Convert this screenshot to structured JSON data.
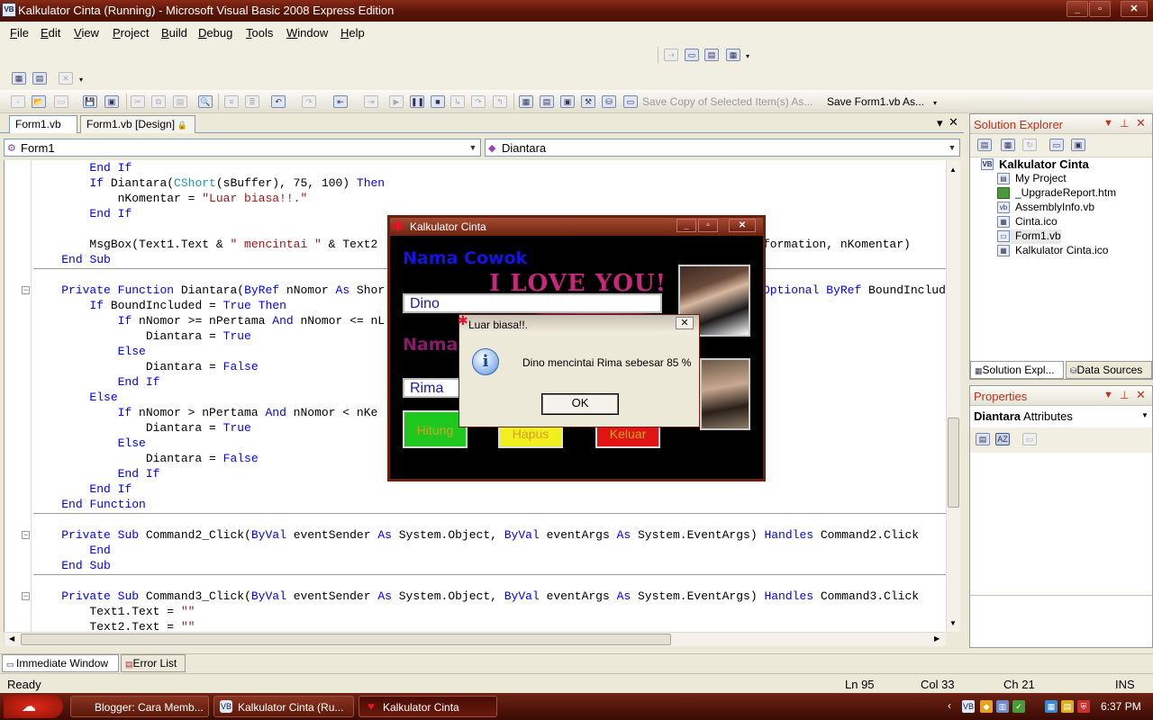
{
  "window": {
    "title": "Kalkulator Cinta (Running) - Microsoft Visual Basic 2008 Express Edition",
    "app_icon": "VB",
    "controls": {
      "minimize": "_",
      "maximize": "▫",
      "close": "✕"
    }
  },
  "menu": [
    {
      "label": "File",
      "u": "F",
      "rest": "ile"
    },
    {
      "label": "Edit",
      "u": "E",
      "rest": "dit"
    },
    {
      "label": "View",
      "u": "V",
      "rest": "iew"
    },
    {
      "label": "Project",
      "u": "P",
      "rest": "roject"
    },
    {
      "label": "Build",
      "u": "B",
      "rest": "uild"
    },
    {
      "label": "Debug",
      "u": "D",
      "rest": "ebug"
    },
    {
      "label": "Tools",
      "u": "T",
      "rest": "ools"
    },
    {
      "label": "Window",
      "u": "W",
      "rest": "indow"
    },
    {
      "label": "Help",
      "u": "H",
      "rest": "elp"
    }
  ],
  "toolbar": {
    "save_copy_label": "Save Copy of Selected Item(s) As...",
    "save_form_label": "Save Form1.vb As..."
  },
  "tabs": [
    {
      "label": "Form1.vb",
      "active": true
    },
    {
      "label": "Form1.vb [Design]",
      "active": false
    }
  ],
  "editor": {
    "class_combo": "Form1",
    "member_combo": "Diantara",
    "close_glyph": "✕"
  },
  "code_lines": [
    "        End If",
    "        If Diantara(CShort(sBuffer), 75, 100) Then",
    "            nKomentar = \"Luar biasa!!.\"",
    "        End If",
    "",
    "        MsgBox(Text1.Text & \" mencintai \" & Text2",
    "    End Sub",
    "",
    "    Private Function Diantara(ByRef nNomor As Shor",
    "        If BoundIncluded = True Then",
    "            If nNomor >= nPertama And nNomor <= nL",
    "                Diantara = True",
    "            Else",
    "                Diantara = False",
    "            End If",
    "        Else",
    "            If nNomor > nPertama And nNomor < nKe",
    "                Diantara = True",
    "            Else",
    "                Diantara = False",
    "            End If",
    "        End If",
    "    End Function",
    "",
    "    Private Sub Command2_Click(ByVal eventSender As System.Object, ByVal eventArgs As System.EventArgs) Handles Command2.Click",
    "        End",
    "    End Sub",
    "",
    "    Private Sub Command3_Click(ByVal eventSender As System.Object, ByVal eventArgs As System.EventArgs) Handles Command3.Click",
    "        Text1.Text = \"\"",
    "        Text2.Text = \"\""
  ],
  "code_overflow": {
    "line6_tail": "formation, nKomentar)",
    "line9_tail": "Optional ByRef BoundInclud"
  },
  "solution_explorer": {
    "title": "Solution Explorer",
    "project": "Kalkulator Cinta",
    "items": [
      "My Project",
      "_UpgradeReport.htm",
      "AssemblyInfo.vb",
      "Cinta.ico",
      "Form1.vb",
      "Kalkulator Cinta.ico"
    ],
    "tab_solution": "Solution Expl...",
    "tab_datasources": "Data Sources"
  },
  "properties": {
    "title": "Properties",
    "object": "Diantara",
    "object_type": "Attributes"
  },
  "app_window": {
    "title": "Kalkulator Cinta",
    "heading_cowok": "Nama Cowok",
    "heading_cewek": "Nama",
    "love_text": "I LOVE YOU!",
    "name_cowok": "Dino",
    "name_cewek": "Rima",
    "btn_hitung": "Hitung",
    "btn_hapus": "Hapus",
    "btn_keluar": "Keluar",
    "colors": {
      "hitung": "#1ec81e",
      "hapus": "#f0f01e",
      "keluar": "#e01414"
    }
  },
  "dialog": {
    "title": "Luar biasa!!.",
    "message": "Dino mencintai Rima sebesar 85 %",
    "ok": "OK",
    "icon": "info-icon"
  },
  "bottom_tabs": [
    "Immediate Window",
    "Error List"
  ],
  "status": {
    "ready": "Ready",
    "ln": "Ln 95",
    "col": "Col 33",
    "ch": "Ch 21",
    "ins": "INS"
  },
  "taskbar": {
    "tasks": [
      "Blogger: Cara Memb...",
      "Kalkulator Cinta (Ru...",
      "Kalkulator Cinta"
    ],
    "clock": "6:37 PM"
  }
}
